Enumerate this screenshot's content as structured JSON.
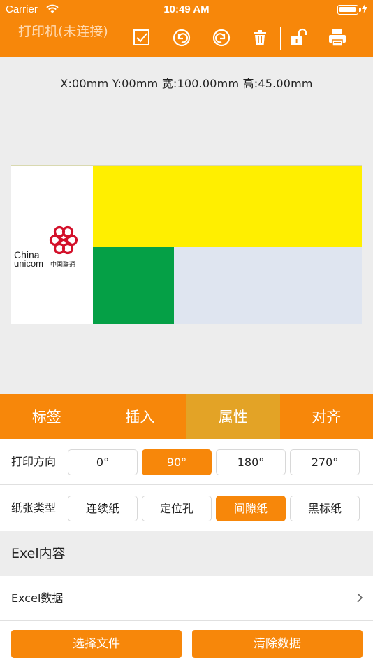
{
  "status_bar": {
    "carrier": "Carrier",
    "time": "10:49 AM"
  },
  "toolbar": {
    "title": "打印机(未连接)",
    "icons": [
      "checkbox-icon",
      "undo-icon",
      "redo-icon",
      "trash-icon",
      "unlock-icon",
      "printer-icon"
    ]
  },
  "canvas": {
    "coords": "X:00mm  Y:00mm  宽:100.00mm  高:45.00mm",
    "logo": {
      "line1": "China",
      "line2": "unicom",
      "line3": "中国联通"
    },
    "colors": {
      "yellow": "#ffef00",
      "green": "#05a046",
      "lightblue": "#dfe5f0"
    }
  },
  "tabs": [
    {
      "label": "标签",
      "active": false
    },
    {
      "label": "插入",
      "active": false
    },
    {
      "label": "属性",
      "active": true
    },
    {
      "label": "对齐",
      "active": false
    }
  ],
  "print_direction": {
    "label": "打印方向",
    "options": [
      "0°",
      "90°",
      "180°",
      "270°"
    ],
    "selected": "90°"
  },
  "paper_type": {
    "label": "纸张类型",
    "options": [
      "连续纸",
      "定位孔",
      "间隙纸",
      "黑标纸"
    ],
    "selected": "间隙纸"
  },
  "excel_section": {
    "title": "Exel内容"
  },
  "excel_row": {
    "label": "Excel数据"
  },
  "bottom_buttons": {
    "select_file": "选择文件",
    "clear_data": "清除数据"
  },
  "theme": {
    "accent": "#f7870a",
    "tab_active": "#e3a326"
  }
}
